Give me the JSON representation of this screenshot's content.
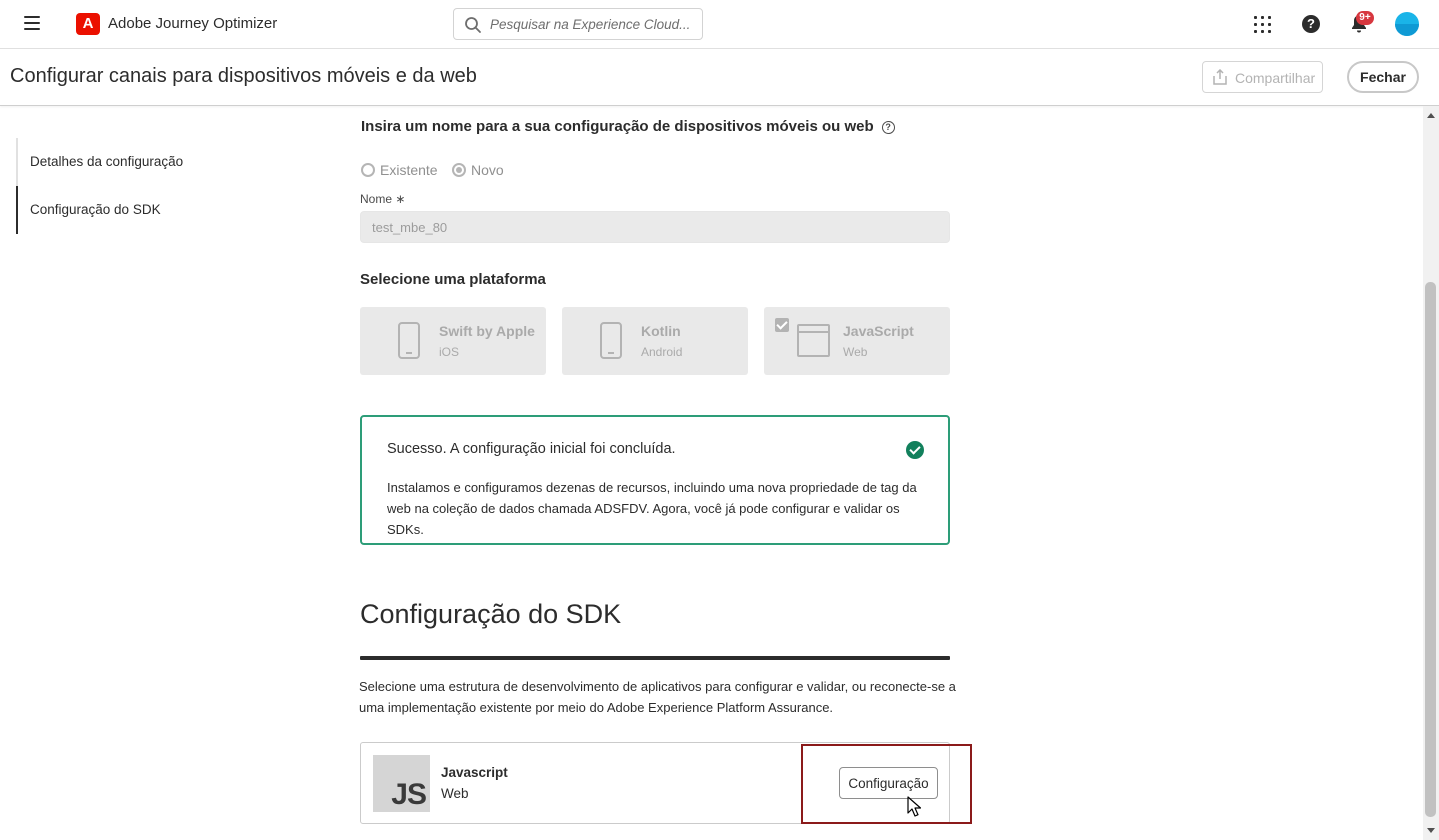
{
  "shell": {
    "app_title": "Adobe Journey Optimizer",
    "search_placeholder": "Pesquisar na Experience Cloud...",
    "notification_count": "9+",
    "brand_color": "#eb1000"
  },
  "header": {
    "title": "Configurar canais para dispositivos móveis e da web",
    "share_label": "Compartilhar",
    "close_label": "Fechar"
  },
  "sidenav": {
    "items": [
      {
        "label": "Detalhes da configuração"
      },
      {
        "label": "Configuração do SDK"
      }
    ]
  },
  "form": {
    "name_prompt": "Insira um nome para a sua configuração de dispositivos móveis ou web",
    "radio_existing": "Existente",
    "radio_new": "Novo",
    "selected_radio": "Novo",
    "name_label": "Nome",
    "required_mark": "∗",
    "name_value": "test_mbe_80",
    "platform_heading": "Selecione uma plataforma",
    "platforms": [
      {
        "title": "Swift by Apple",
        "subtitle": "iOS",
        "icon": "phone-icon",
        "checked": false
      },
      {
        "title": "Kotlin",
        "subtitle": "Android",
        "icon": "phone-icon",
        "checked": false
      },
      {
        "title": "JavaScript",
        "subtitle": "Web",
        "icon": "browser-icon",
        "checked": true
      }
    ]
  },
  "success": {
    "title": "Sucesso. A configuração inicial foi concluída.",
    "body": "Instalamos e configuramos dezenas de recursos, incluindo uma nova propriedade de tag da web na coleção de dados chamada ADSFDV. Agora, você já pode configurar e validar os SDKs.",
    "accent": "#2d9d78"
  },
  "sdk": {
    "heading": "Configuração do SDK",
    "description": "Selecione uma estrutura de desenvolvimento de aplicativos para configurar e validar, ou reconecte-se a uma implementação existente por meio do Adobe Experience Platform Assurance.",
    "card": {
      "logo_text": "JS",
      "title": "Javascript",
      "subtitle": "Web",
      "button_label": "Configuração"
    }
  }
}
